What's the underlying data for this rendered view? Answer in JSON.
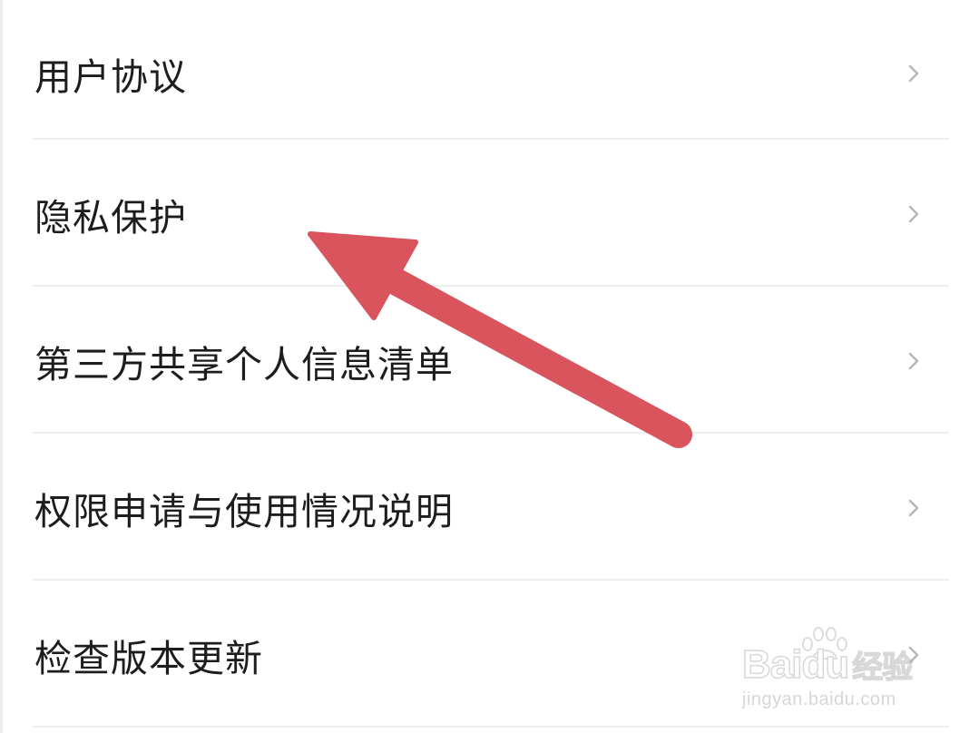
{
  "menu": {
    "items": [
      {
        "label": "用户协议"
      },
      {
        "label": "隐私保护"
      },
      {
        "label": "第三方共享个人信息清单"
      },
      {
        "label": "权限申请与使用情况说明"
      },
      {
        "label": "检查版本更新"
      }
    ],
    "chevron_icon": "chevron-right-icon",
    "chevron_color": "#b5b5b5",
    "divider_color": "#eeeeee",
    "text_color": "#1d1d1d"
  },
  "annotation": {
    "arrow_color": "#d9545c",
    "points_to": "隐私保护"
  },
  "watermark": {
    "brand": "Baidu",
    "brand_cn": "经验",
    "url": "jingyan.baidu.com"
  }
}
